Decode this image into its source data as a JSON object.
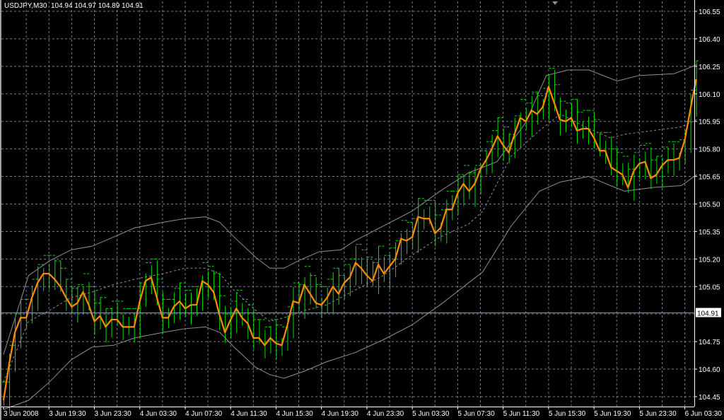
{
  "header": {
    "symbol": "USDJPY,M30",
    "open": "104.94",
    "high": "104.97",
    "low": "104.89",
    "close": "104.91"
  },
  "colors": {
    "background": "#000000",
    "grid": "#6f7f8f",
    "bars": "#00e000",
    "close_line": "#ff8c00",
    "bands": "#909090",
    "axis": "#ffffff"
  },
  "chart_data": {
    "type": "line",
    "title": "USDJPY,M30",
    "ylim": [
      104.4,
      106.6
    ],
    "grid": true,
    "price_ticks": [
      "106.55",
      "106.40",
      "106.25",
      "106.10",
      "105.95",
      "105.80",
      "105.65",
      "105.50",
      "105.35",
      "105.20",
      "105.05",
      "104.75",
      "104.60",
      "104.45"
    ],
    "grid_prices": [
      106.55,
      106.4,
      106.25,
      106.1,
      105.95,
      105.8,
      105.65,
      105.5,
      105.35,
      105.2,
      105.05,
      104.9,
      104.75,
      104.6,
      104.45
    ],
    "current_price": {
      "label": "104.91",
      "value": 104.91
    },
    "time_ticks": [
      "3 Jun 2008",
      "3 Jun 19:30",
      "3 Jun 23:30",
      "4 Jun 03:30",
      "4 Jun 07:30",
      "4 Jun 11:30",
      "4 Jun 15:30",
      "4 Jun 19:30",
      "4 Jun 23:30",
      "5 Jun 03:30",
      "5 Jun 07:30",
      "5 Jun 11:30",
      "5 Jun 15:30",
      "5 Jun 19:30",
      "5 Jun 23:30",
      "6 Jun 03:30"
    ],
    "bars_per_time_tick": 8,
    "close": [
      104.43,
      104.63,
      104.8,
      104.88,
      104.88,
      104.99,
      105.07,
      105.12,
      105.12,
      105.09,
      105.05,
      104.99,
      104.94,
      104.96,
      105.02,
      104.95,
      104.86,
      104.89,
      104.83,
      104.87,
      104.87,
      104.83,
      104.83,
      104.83,
      104.97,
      105.08,
      105.1,
      104.99,
      104.88,
      104.88,
      104.94,
      104.97,
      104.93,
      104.95,
      104.95,
      105.08,
      105.06,
      105.02,
      104.9,
      104.8,
      104.87,
      104.93,
      104.88,
      104.85,
      104.77,
      104.77,
      104.73,
      104.77,
      104.74,
      104.73,
      104.84,
      104.97,
      104.96,
      105.06,
      105.01,
      104.96,
      104.95,
      104.99,
      105.05,
      105.01,
      105.07,
      105.1,
      105.18,
      105.15,
      105.11,
      105.08,
      105.17,
      105.12,
      105.16,
      105.2,
      105.31,
      105.3,
      105.32,
      105.43,
      105.42,
      105.42,
      105.34,
      105.37,
      105.47,
      105.47,
      105.56,
      105.61,
      105.57,
      105.61,
      105.69,
      105.74,
      105.8,
      105.87,
      105.82,
      105.78,
      105.88,
      105.97,
      105.95,
      106.01,
      105.99,
      106.03,
      106.14,
      106.05,
      105.96,
      105.95,
      105.97,
      105.9,
      105.91,
      105.91,
      105.86,
      105.79,
      105.79,
      105.7,
      105.68,
      105.66,
      105.59,
      105.68,
      105.72,
      105.73,
      105.64,
      105.66,
      105.71,
      105.74,
      105.74,
      105.75,
      105.85,
      106.02,
      106.18
    ],
    "bands": {
      "upper": [
        [
          0,
          104.68
        ],
        [
          4.4,
          105.11
        ],
        [
          8.1,
          105.19
        ],
        [
          11.9,
          105.25
        ],
        [
          15.6,
          105.27
        ],
        [
          19.4,
          105.32
        ],
        [
          23.1,
          105.37
        ],
        [
          28.1,
          105.4
        ],
        [
          31.9,
          105.42
        ],
        [
          35.6,
          105.43
        ],
        [
          38.1,
          105.4
        ],
        [
          40.6,
          105.32
        ],
        [
          44.4,
          105.21
        ],
        [
          46.9,
          105.15
        ],
        [
          49.4,
          105.15
        ],
        [
          51.9,
          105.19
        ],
        [
          55.6,
          105.24
        ],
        [
          59.4,
          105.25
        ],
        [
          61.9,
          105.3
        ],
        [
          66.9,
          105.38
        ],
        [
          71.9,
          105.46
        ],
        [
          76.9,
          105.57
        ],
        [
          81.9,
          105.67
        ],
        [
          86.9,
          105.73
        ],
        [
          91.9,
          105.94
        ],
        [
          95.6,
          106.2
        ],
        [
          99.4,
          106.23
        ],
        [
          103.1,
          106.23
        ],
        [
          108.1,
          106.17
        ],
        [
          111.9,
          106.2
        ],
        [
          118.1,
          106.21
        ],
        [
          120.6,
          106.24
        ],
        [
          122.1,
          106.26
        ]
      ],
      "middle": [
        [
          0,
          104.53
        ],
        [
          4.4,
          104.86
        ],
        [
          8.1,
          104.92
        ],
        [
          11.9,
          104.99
        ],
        [
          15.6,
          105.02
        ],
        [
          19.4,
          105.06
        ],
        [
          23.1,
          105.09
        ],
        [
          28.1,
          105.12
        ],
        [
          31.9,
          105.15
        ],
        [
          35.6,
          105.15
        ],
        [
          38.1,
          105.12
        ],
        [
          40.6,
          105.03
        ],
        [
          44.4,
          104.92
        ],
        [
          46.9,
          104.86
        ],
        [
          49.4,
          104.88
        ],
        [
          53.1,
          104.92
        ],
        [
          56.9,
          104.95
        ],
        [
          61.9,
          105.03
        ],
        [
          66.9,
          105.11
        ],
        [
          71.9,
          105.22
        ],
        [
          76.9,
          105.32
        ],
        [
          81.9,
          105.39
        ],
        [
          84.4,
          105.46
        ],
        [
          89.4,
          105.76
        ],
        [
          94.4,
          105.9
        ],
        [
          98.1,
          105.99
        ],
        [
          103.1,
          105.91
        ],
        [
          106.9,
          105.86
        ],
        [
          109.4,
          105.88
        ],
        [
          114.4,
          105.9
        ],
        [
          119.4,
          105.92
        ],
        [
          122.1,
          105.96
        ]
      ],
      "lower": [
        [
          0,
          104.38
        ],
        [
          4.4,
          104.43
        ],
        [
          8.1,
          104.53
        ],
        [
          11.9,
          104.65
        ],
        [
          15.6,
          104.72
        ],
        [
          19.4,
          104.73
        ],
        [
          23.1,
          104.77
        ],
        [
          28.1,
          104.8
        ],
        [
          31.9,
          104.82
        ],
        [
          35.6,
          104.83
        ],
        [
          38.1,
          104.8
        ],
        [
          40.6,
          104.72
        ],
        [
          44.4,
          104.61
        ],
        [
          46.9,
          104.57
        ],
        [
          49.4,
          104.55
        ],
        [
          53.1,
          104.59
        ],
        [
          56.9,
          104.64
        ],
        [
          61.9,
          104.69
        ],
        [
          66.9,
          104.76
        ],
        [
          71.9,
          104.84
        ],
        [
          76.9,
          104.95
        ],
        [
          81.9,
          105.07
        ],
        [
          84.4,
          105.13
        ],
        [
          89.4,
          105.38
        ],
        [
          94.4,
          105.57
        ],
        [
          98.1,
          105.62
        ],
        [
          103.1,
          105.65
        ],
        [
          106.9,
          105.6
        ],
        [
          109.4,
          105.57
        ],
        [
          114.4,
          105.59
        ],
        [
          119.4,
          105.6
        ],
        [
          122.1,
          105.66
        ]
      ]
    }
  }
}
